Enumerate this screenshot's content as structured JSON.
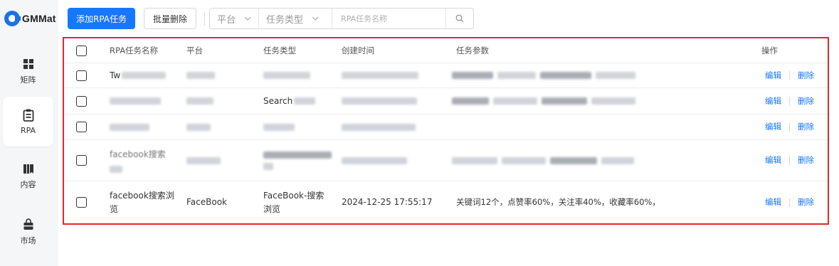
{
  "app": {
    "logo_text": "GMMat",
    "accent": "#1677ff"
  },
  "sidebar": {
    "items": [
      {
        "label": "矩阵",
        "icon": "grid-icon"
      },
      {
        "label": "RPA",
        "icon": "clipboard-icon",
        "active": true
      },
      {
        "label": "内容",
        "icon": "book-icon"
      },
      {
        "label": "市场",
        "icon": "shopping-bag-icon"
      }
    ]
  },
  "toolbar": {
    "add_label": "添加RPA任务",
    "bulk_delete_label": "批量删除",
    "platform_placeholder": "平台",
    "task_type_placeholder": "任务类型",
    "search_placeholder": "RPA任务名称"
  },
  "table": {
    "headers": {
      "name": "RPA任务名称",
      "platform": "平台",
      "task_type": "任务类型",
      "created": "创建时间",
      "params": "任务参数",
      "actions": "操作"
    },
    "edit_label": "编辑",
    "delete_label": "删除",
    "visible_fragments": {
      "row1_name_prefix": "Tw",
      "row2_type_prefix": "Search",
      "row4_name_prefix": "facebook搜索"
    },
    "last_row": {
      "name": "facebook搜索浏览",
      "platform": "FaceBook",
      "task_type": "FaceBook-搜索浏览",
      "created": "2024-12-25 17:55:17",
      "params": "关键词12个，点赞率60%，关注率40%，收藏率60%，"
    }
  }
}
